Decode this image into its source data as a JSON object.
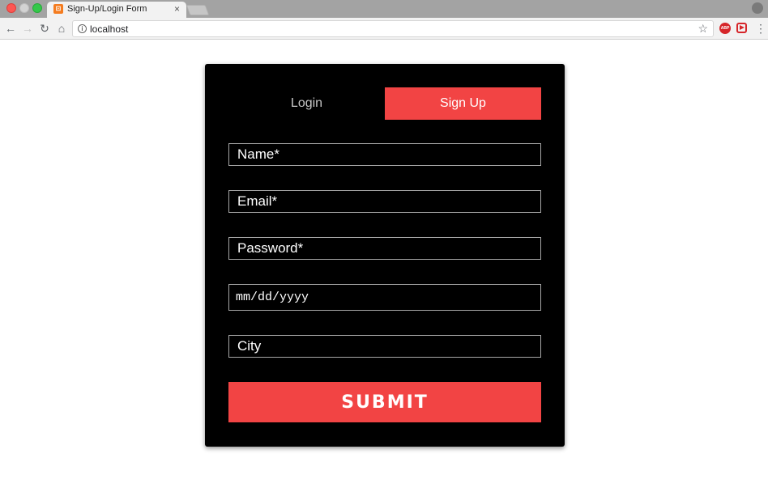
{
  "browser": {
    "tab_title": "Sign-Up/Login Form",
    "tab_close": "×",
    "url": "localhost",
    "extensions": {
      "abp_label": "ABP"
    }
  },
  "icons": {
    "back": "arrow-left-icon",
    "forward": "arrow-right-icon",
    "reload": "reload-icon",
    "home": "home-icon",
    "info": "info-icon",
    "star": "star-icon",
    "menu": "menu-dots-icon",
    "profile": "profile-icon"
  },
  "colors": {
    "accent": "#f24444",
    "card_bg": "#000000",
    "page_bg": "#ffffff"
  },
  "form": {
    "tabs": {
      "login": "Login",
      "signup": "Sign Up",
      "active": "signup"
    },
    "fields": {
      "name_placeholder": "Name*",
      "email_placeholder": "Email*",
      "password_placeholder": "Password*",
      "date_placeholder": "mm/dd/yyyy",
      "city_placeholder": "City"
    },
    "submit_label": "SUBMIT"
  }
}
